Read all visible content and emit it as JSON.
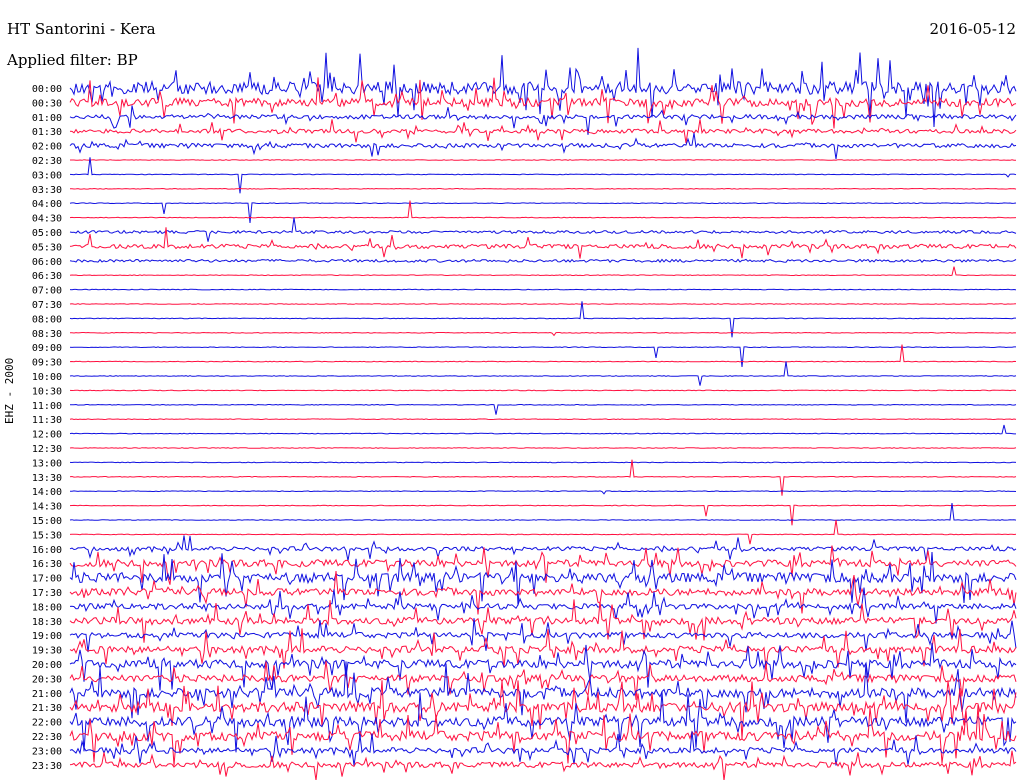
{
  "header": {
    "station": "HT Santorini - Kera",
    "filter": "Applied filter: BP",
    "date": "2016-05-12",
    "channel": "EHZ - 2000"
  },
  "colors": {
    "trace_a": "#1010e0",
    "trace_b": "#ff1040",
    "background": "#ffffff",
    "text": "#000000"
  },
  "chart_data": {
    "type": "helicorder",
    "title": "HT Santorini - Kera",
    "subtitle": "Applied filter: BP",
    "date": "2016-05-12",
    "ylabel": "EHZ - 2000",
    "rows": [
      "00:00",
      "00:30",
      "01:00",
      "01:30",
      "02:00",
      "02:30",
      "03:00",
      "03:30",
      "04:00",
      "04:30",
      "05:00",
      "05:30",
      "06:00",
      "06:30",
      "07:00",
      "07:30",
      "08:00",
      "08:30",
      "09:00",
      "09:30",
      "10:00",
      "10:30",
      "11:00",
      "11:30",
      "12:00",
      "12:30",
      "13:00",
      "13:30",
      "14:00",
      "14:30",
      "15:00",
      "15:30",
      "16:00",
      "16:30",
      "17:00",
      "17:30",
      "18:00",
      "18:30",
      "19:00",
      "19:30",
      "20:00",
      "20:30",
      "21:00",
      "21:30",
      "22:00",
      "22:30",
      "23:00",
      "23:30"
    ],
    "row_colors": [
      "trace_a",
      "trace_b"
    ],
    "activity_level": [
      9,
      6,
      3,
      3,
      3,
      1,
      1,
      1,
      1,
      1,
      2,
      3,
      2,
      1,
      1,
      1,
      1,
      1,
      1,
      1,
      1,
      1,
      1,
      1,
      1,
      1,
      1,
      1,
      1,
      1,
      1,
      1,
      3,
      5,
      7,
      5,
      4,
      5,
      4,
      5,
      6,
      5,
      7,
      7,
      7,
      7,
      4,
      4
    ]
  }
}
